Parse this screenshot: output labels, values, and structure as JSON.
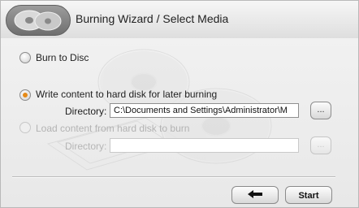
{
  "window": {
    "title": "Burning Wizard / Select Media",
    "logo_icon": "disc-badge-icon"
  },
  "options": {
    "burn_to_disc": {
      "label": "Burn to Disc",
      "selected": false,
      "enabled": true
    },
    "write_to_hdd": {
      "label": "Write content to hard disk for later burning",
      "selected": true,
      "enabled": true,
      "directory_label": "Directory:",
      "directory_value": "C:\\Documents and Settings\\Administrator\\M",
      "browse_label": "..."
    },
    "load_from_hdd": {
      "label": "Load content from hard disk to burn",
      "selected": false,
      "enabled": false,
      "directory_label": "Directory:",
      "directory_value": "",
      "browse_label": "..."
    }
  },
  "buttons": {
    "back_icon": "arrow-left-icon",
    "start_label": "Start"
  },
  "colors": {
    "accent": "#e58a18",
    "disabled_text": "#b3b3b3"
  }
}
